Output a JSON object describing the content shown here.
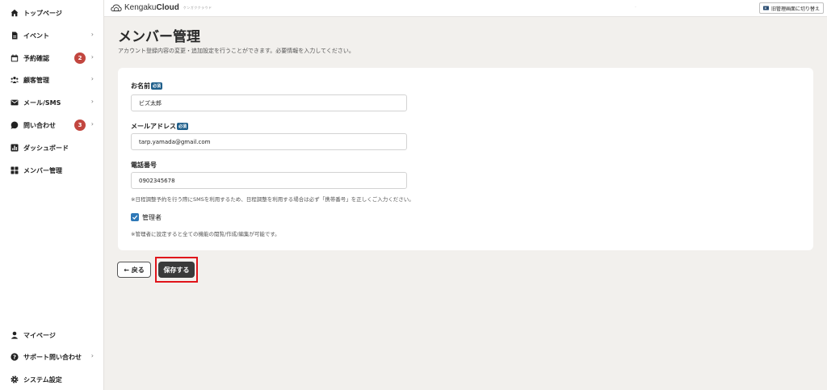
{
  "sidebar": {
    "items": [
      {
        "label": "トップページ",
        "icon": "home-icon"
      },
      {
        "label": "イベント",
        "icon": "document-icon",
        "chevron": "›"
      },
      {
        "label": "予約確認",
        "icon": "calendar-icon",
        "badge": "2",
        "chevron": "›"
      },
      {
        "label": "顧客管理",
        "icon": "people-icon",
        "chevron": "›"
      },
      {
        "label": "メール/SMS",
        "icon": "mail-icon",
        "chevron": "›"
      },
      {
        "label": "問い合わせ",
        "icon": "chat-bubble-icon",
        "badge": "3",
        "chevron": "›"
      },
      {
        "label": "ダッシュボード",
        "icon": "bar-chart-icon"
      },
      {
        "label": "メンバー管理",
        "icon": "grid-icon"
      }
    ],
    "bottom_items": [
      {
        "label": "マイページ",
        "icon": "user-icon"
      },
      {
        "label": "サポート問い合わせ",
        "icon": "help-icon",
        "chevron": "›"
      },
      {
        "label": "システム設定",
        "icon": "gear-icon"
      }
    ]
  },
  "header": {
    "logo_text_light": "Kengaku",
    "logo_text_bold": "Cloud",
    "logo_sub": "ケンガククラウド",
    "switch_label": "旧管理画面に切り替え"
  },
  "main": {
    "title": "メンバー管理",
    "description": "アカウント登録内容の変更・追加設定を行うことができます。必要情報を入力してください。",
    "form": {
      "name_label": "お名前",
      "name_value": "ビズ太郎",
      "required_badge": "必須",
      "email_label": "メールアドレス",
      "email_value": "tarp.yamada@gmail.com",
      "phone_label": "電話番号",
      "phone_value": "0902345678",
      "phone_note": "※日程調整予約を行う際にSMSを利用するため、日程調整を利用する場合は必ず「携帯番号」を正しくご入力ください。",
      "admin_label": "管理者",
      "admin_checked": true,
      "admin_note": "※管理者に設定すると全ての機能の閲覧/作成/編集が可能です。"
    },
    "back_label": "← 戻る",
    "save_label": "保存する"
  },
  "colors": {
    "badge": "#c2463f",
    "required": "#1f5f8b",
    "checkbox": "#2e78b7",
    "save_button": "#3a3a3a",
    "highlight": "#e0141a"
  }
}
